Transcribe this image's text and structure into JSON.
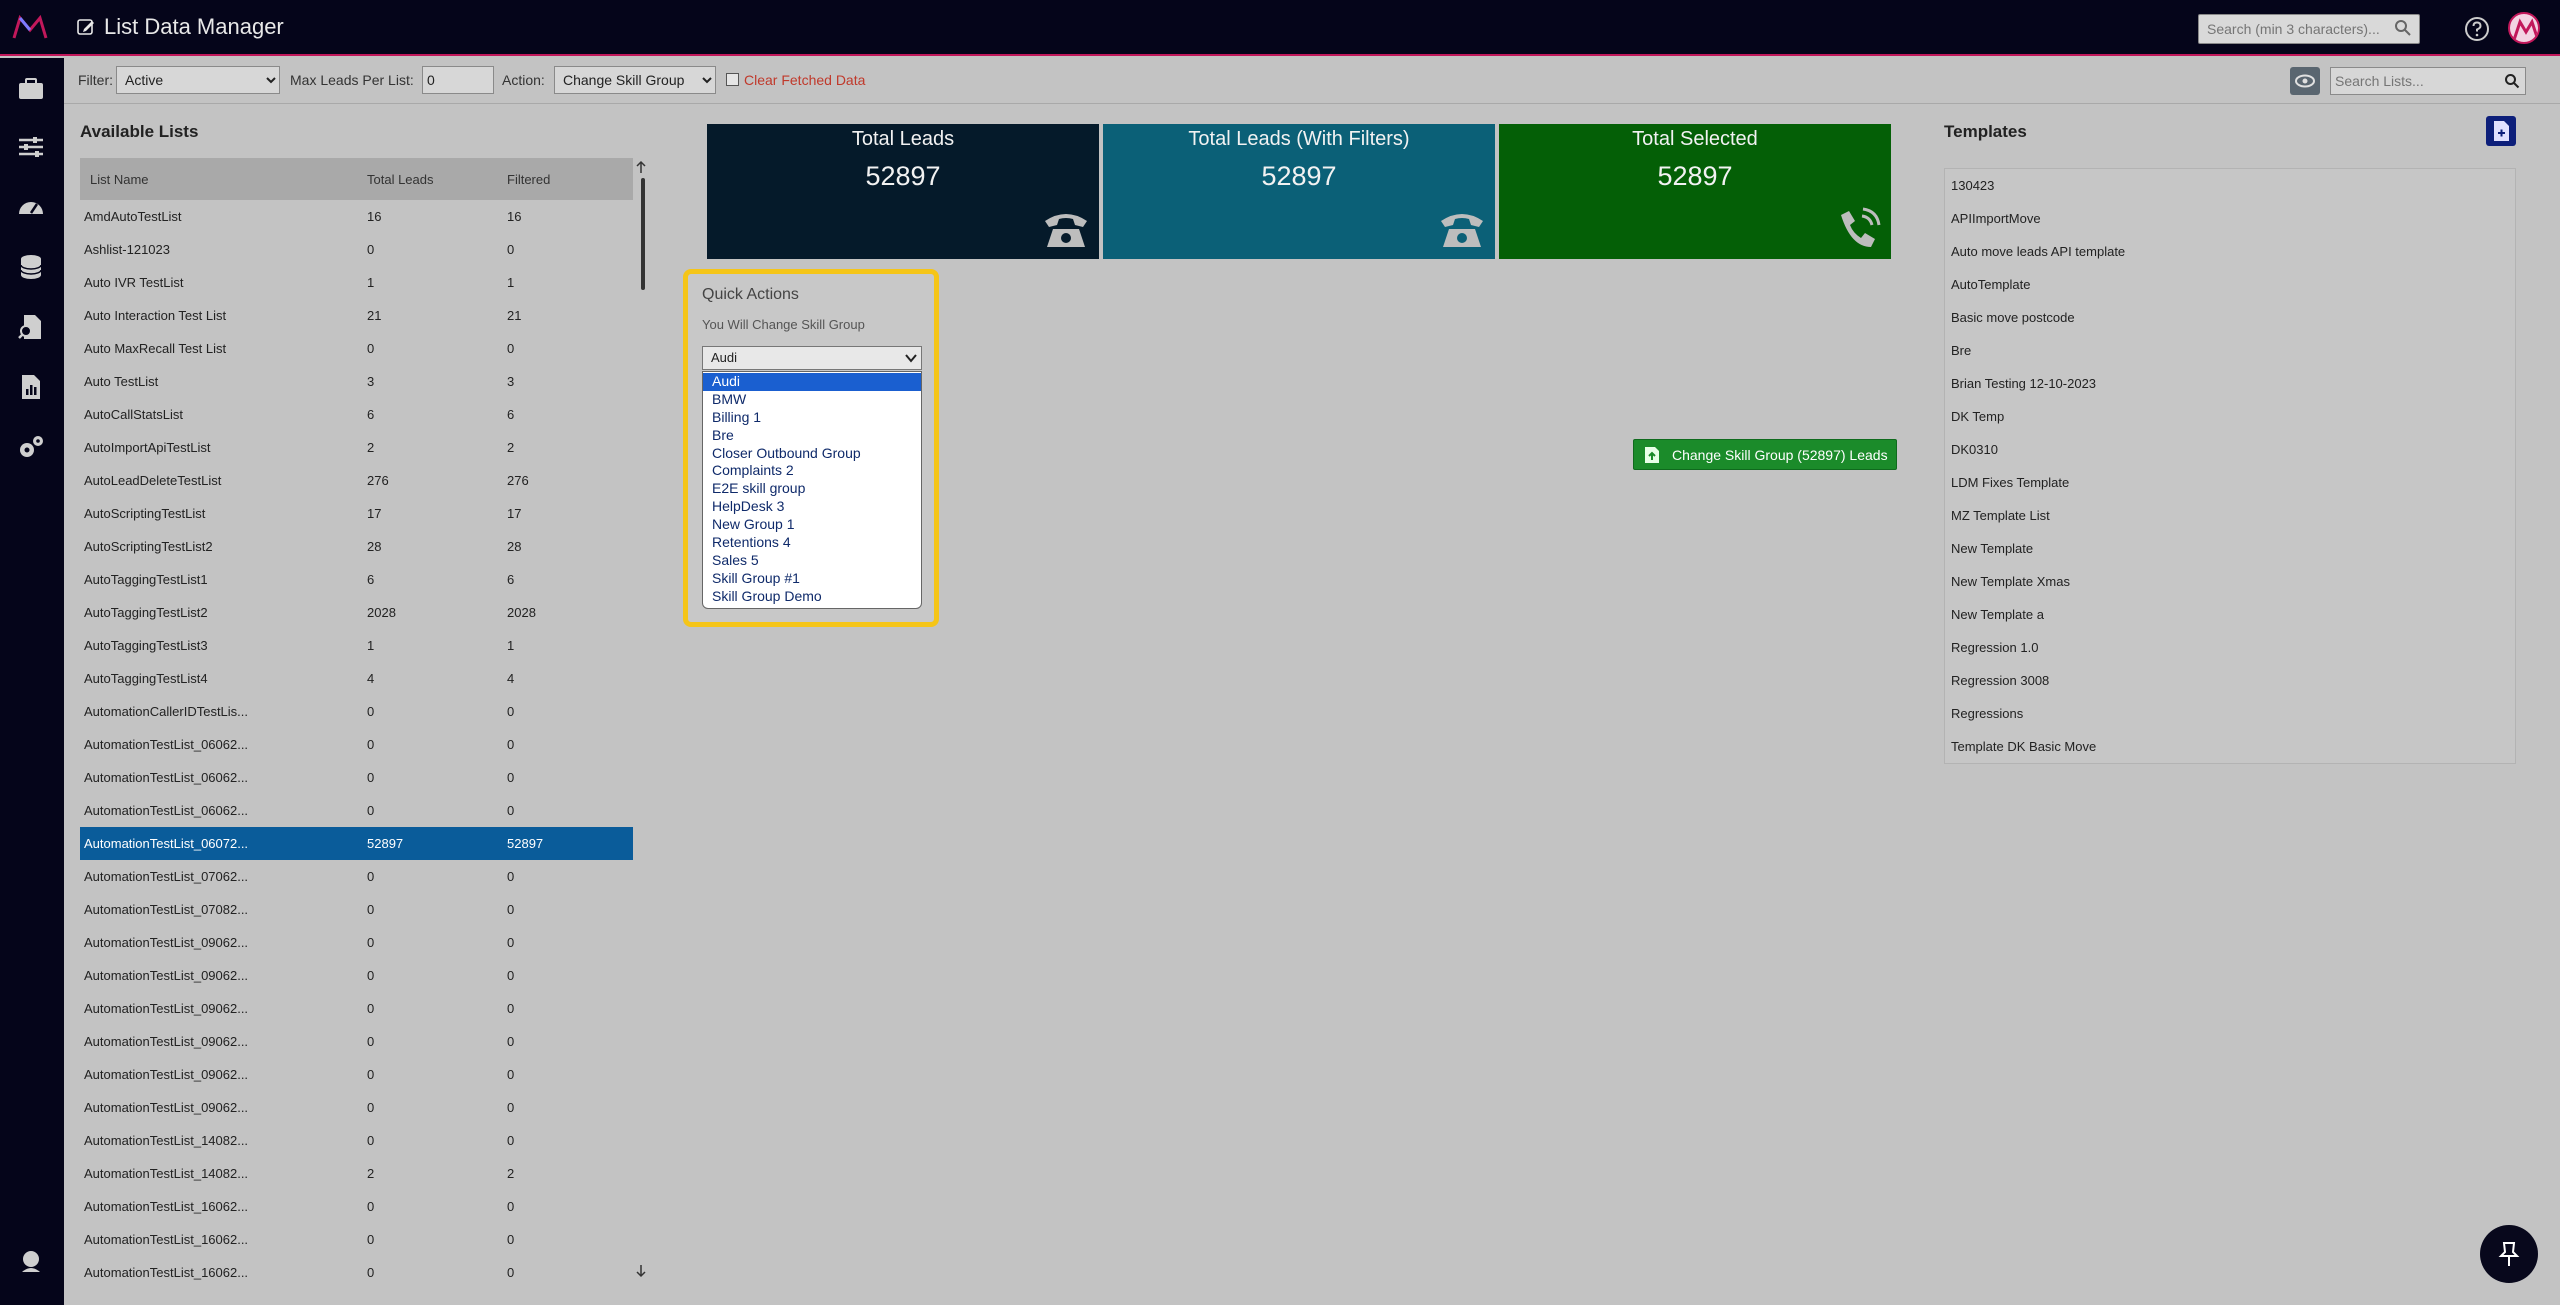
{
  "header": {
    "title": "List Data Manager",
    "search_placeholder": "Search (min 3 characters)..."
  },
  "toolbar": {
    "filter_label": "Filter:",
    "filter_value": "Active",
    "max_leads_label": "Max Leads Per List:",
    "max_leads_value": "0",
    "action_label": "Action:",
    "action_value": "Change Skill Group",
    "clear_fetched_label": "Clear Fetched Data",
    "search_lists_placeholder": "Search Lists..."
  },
  "available_lists": {
    "title": "Available Lists",
    "columns": [
      "List Name",
      "Total Leads",
      "Filtered"
    ],
    "rows": [
      [
        "AmdAutoTestList",
        "16",
        "16"
      ],
      [
        "Ashlist-121023",
        "0",
        "0"
      ],
      [
        "Auto IVR TestList",
        "1",
        "1"
      ],
      [
        "Auto Interaction Test List",
        "21",
        "21"
      ],
      [
        "Auto MaxRecall Test List",
        "0",
        "0"
      ],
      [
        "Auto TestList",
        "3",
        "3"
      ],
      [
        "AutoCallStatsList",
        "6",
        "6"
      ],
      [
        "AutoImportApiTestList",
        "2",
        "2"
      ],
      [
        "AutoLeadDeleteTestList",
        "276",
        "276"
      ],
      [
        "AutoScriptingTestList",
        "17",
        "17"
      ],
      [
        "AutoScriptingTestList2",
        "28",
        "28"
      ],
      [
        "AutoTaggingTestList1",
        "6",
        "6"
      ],
      [
        "AutoTaggingTestList2",
        "2028",
        "2028"
      ],
      [
        "AutoTaggingTestList3",
        "1",
        "1"
      ],
      [
        "AutoTaggingTestList4",
        "4",
        "4"
      ],
      [
        "AutomationCallerIDTestLis...",
        "0",
        "0"
      ],
      [
        "AutomationTestList_06062...",
        "0",
        "0"
      ],
      [
        "AutomationTestList_06062...",
        "0",
        "0"
      ],
      [
        "AutomationTestList_06062...",
        "0",
        "0"
      ],
      [
        "AutomationTestList_06072...",
        "52897",
        "52897"
      ],
      [
        "AutomationTestList_07062...",
        "0",
        "0"
      ],
      [
        "AutomationTestList_07082...",
        "0",
        "0"
      ],
      [
        "AutomationTestList_09062...",
        "0",
        "0"
      ],
      [
        "AutomationTestList_09062...",
        "0",
        "0"
      ],
      [
        "AutomationTestList_09062...",
        "0",
        "0"
      ],
      [
        "AutomationTestList_09062...",
        "0",
        "0"
      ],
      [
        "AutomationTestList_09062...",
        "0",
        "0"
      ],
      [
        "AutomationTestList_09062...",
        "0",
        "0"
      ],
      [
        "AutomationTestList_14082...",
        "0",
        "0"
      ],
      [
        "AutomationTestList_14082...",
        "2",
        "2"
      ],
      [
        "AutomationTestList_16062...",
        "0",
        "0"
      ],
      [
        "AutomationTestList_16062...",
        "0",
        "0"
      ],
      [
        "AutomationTestList_16062...",
        "0",
        "0"
      ]
    ],
    "selected_index": 19
  },
  "stats": [
    {
      "title": "Total Leads",
      "value": "52897",
      "color": "#051a2a",
      "icon": "phone-icon"
    },
    {
      "title": "Total Leads (With Filters)",
      "value": "52897",
      "color": "#0b6077",
      "icon": "phone-icon"
    },
    {
      "title": "Total Selected",
      "value": "52897",
      "color": "#045f06",
      "icon": "phone-ringing-icon"
    }
  ],
  "quick_actions": {
    "title": "Quick Actions",
    "subtitle": "You Will Change Skill Group",
    "selected": "Audi",
    "options": [
      "Audi",
      "BMW",
      "Billing 1",
      "Bre",
      "Closer Outbound Group",
      "Complaints 2",
      "E2E skill group",
      "HelpDesk 3",
      "New Group 1",
      "Retentions 4",
      "Sales 5",
      "Skill Group #1",
      "Skill Group Demo"
    ]
  },
  "change_button_label": "Change Skill Group (52897) Leads",
  "templates": {
    "title": "Templates",
    "items": [
      "130423",
      "APIImportMove",
      "Auto move leads API template",
      "AutoTemplate",
      "Basic move postcode",
      "Bre",
      "Brian Testing 12-10-2023",
      "DK Temp",
      "DK0310",
      "LDM Fixes Template",
      "MZ Template List",
      "New Template",
      "New Template Xmas",
      "New Template a",
      "Regression 1.0",
      "Regression 3008",
      "Regressions",
      "Template DK Basic Move"
    ]
  },
  "colors": {
    "topbar": "#05051a",
    "accent_pink": "#c2185b",
    "selected_row": "#0a5c9a",
    "green_button": "#1b8b2a",
    "highlight_border": "#f5c518"
  }
}
